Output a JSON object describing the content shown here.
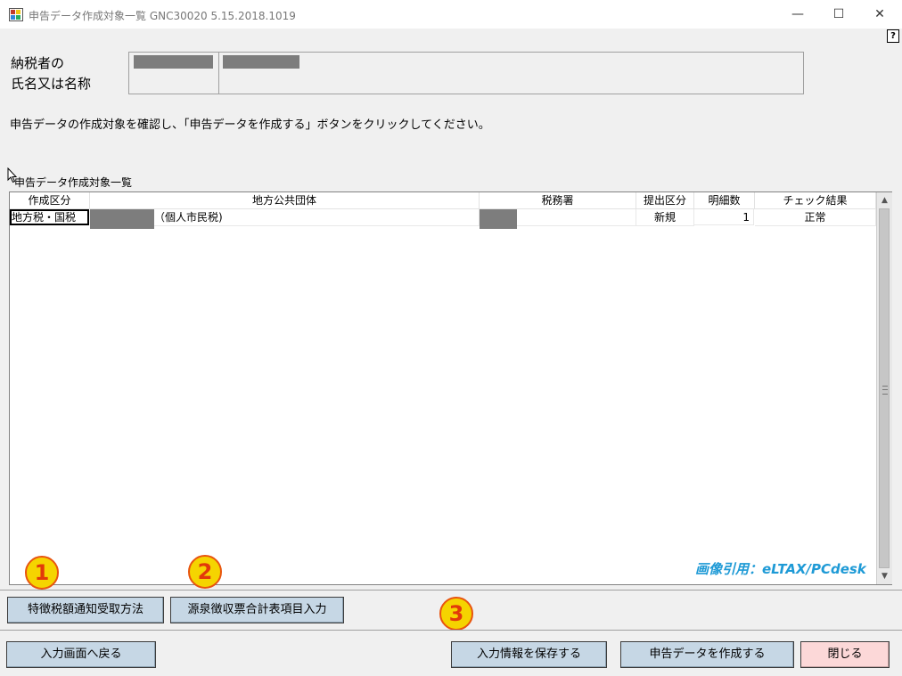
{
  "window": {
    "title": "申告データ作成対象一覧 GNC30020  5.15.2018.1019",
    "minimize": "—",
    "maximize": "☐",
    "close": "✕",
    "help": "?"
  },
  "taxpayer": {
    "label_line1": "納税者の",
    "label_line2": "氏名又は名称"
  },
  "instruction": "申告データの作成対象を確認し、「申告データを作成する」ボタンをクリックしてください。",
  "grid": {
    "caption": "申告データ作成対象一覧",
    "columns": [
      "作成区分",
      "地方公共団体",
      "税務署",
      "提出区分",
      "明細数",
      "チェック結果"
    ],
    "rows": [
      {
        "type": "地方税・国税",
        "municipality_suffix": "（個人市民税)",
        "tax_office": "",
        "submission": "新規",
        "count": "1",
        "check": "正常"
      }
    ]
  },
  "watermark": "画像引用：eLTAX/PCdesk",
  "badges": [
    "1",
    "2",
    "3"
  ],
  "buttons": {
    "notice_method": "特徴税額通知受取方法",
    "withholding_summary": "源泉徴収票合計表項目入力",
    "back": "入力画面へ戻る",
    "save": "入力情報を保存する",
    "create": "申告データを作成する",
    "close": "閉じる"
  }
}
